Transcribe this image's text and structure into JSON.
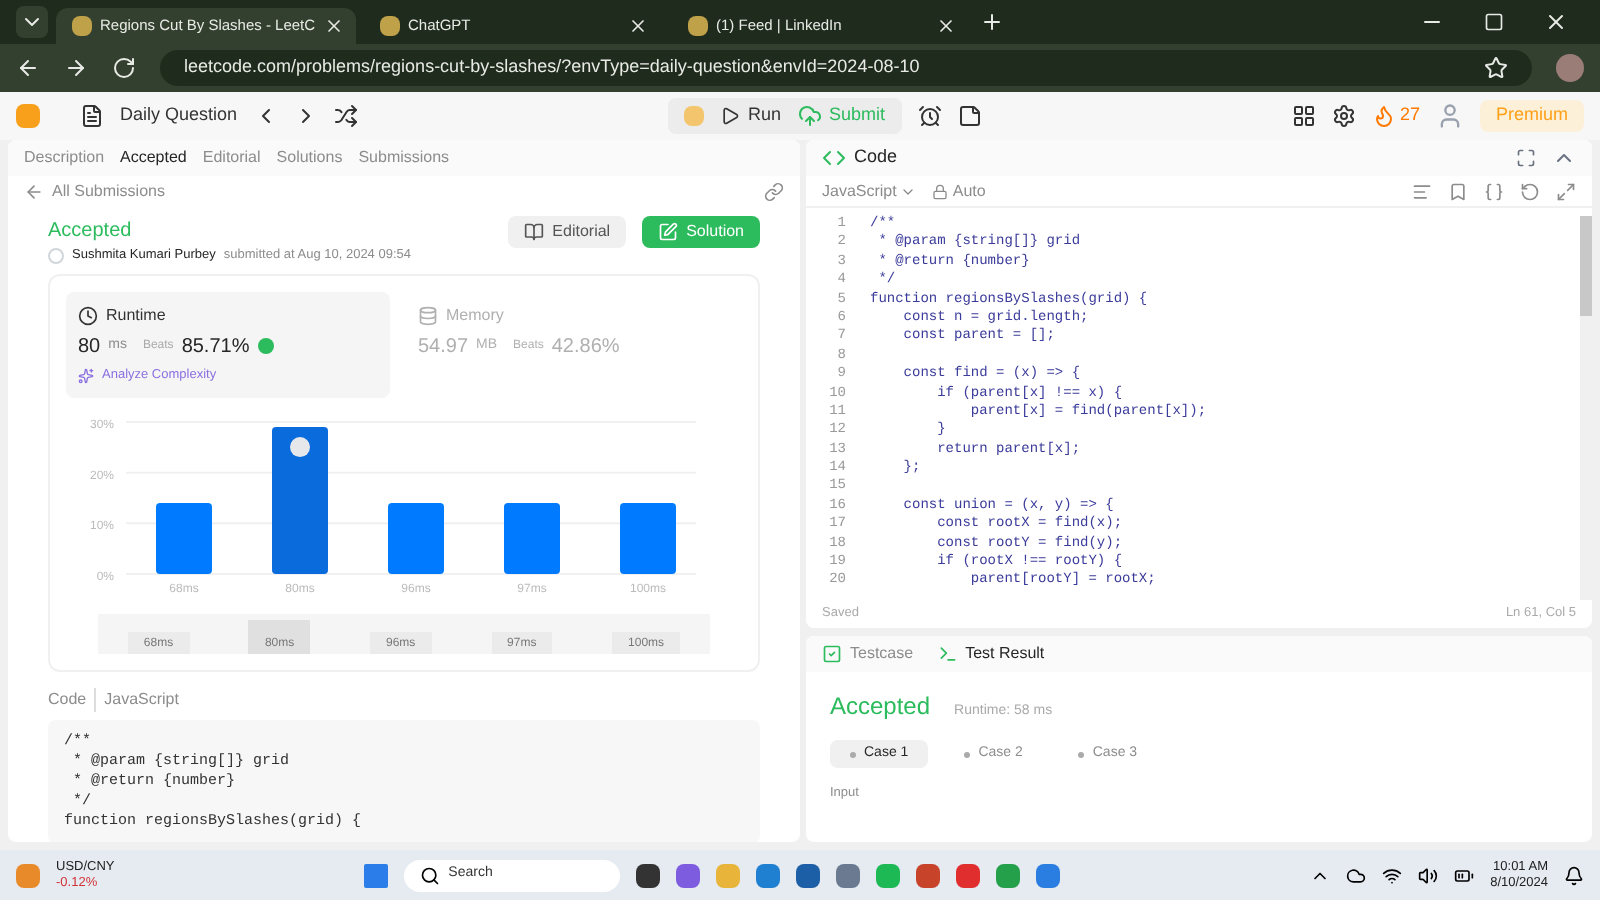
{
  "browser": {
    "tabs": [
      {
        "title": "Regions Cut By Slashes - LeetC",
        "selected": true
      },
      {
        "title": "ChatGPT",
        "selected": false
      },
      {
        "title": "(1) Feed | LinkedIn",
        "selected": false
      }
    ],
    "url": "leetcode.com/problems/regions-cut-by-slashes/?envType=daily-question&envId=2024-08-10"
  },
  "nav": {
    "title": "Daily Question",
    "run": "Run",
    "submit": "Submit",
    "streak": "27",
    "premium": "Premium"
  },
  "left": {
    "tabs": [
      {
        "label": "Description",
        "selected": false
      },
      {
        "label": "Accepted",
        "selected": true
      },
      {
        "label": "Editorial",
        "selected": false
      },
      {
        "label": "Solutions",
        "selected": false
      },
      {
        "label": "Submissions",
        "selected": false
      }
    ],
    "back": "All Submissions",
    "status": "Accepted",
    "user": "Sushmita Kumari Purbey",
    "submitted": "submitted at Aug 10, 2024 09:54",
    "editorial_button": "Editorial",
    "solution_button": "Solution",
    "runtime": {
      "label": "Runtime",
      "value": "80",
      "unit": "ms",
      "beats_label": "Beats",
      "beats": "85.71%",
      "analyze": "Analyze Complexity"
    },
    "memory": {
      "label": "Memory",
      "value": "54.97",
      "unit": "MB",
      "beats_label": "Beats",
      "beats": "42.86%"
    },
    "chart_data": {
      "type": "bar",
      "categories": [
        "68ms",
        "80ms",
        "96ms",
        "97ms",
        "100ms"
      ],
      "values": [
        14,
        29,
        14,
        14,
        14
      ],
      "ylim": [
        0,
        30
      ],
      "yticks": [
        {
          "value": 0,
          "label": "0%"
        },
        {
          "value": 10,
          "label": "10%"
        },
        {
          "value": 20,
          "label": "20%"
        },
        {
          "value": 30,
          "label": "30%"
        }
      ]
    },
    "range_labels": [
      {
        "label": "68ms",
        "selected": false
      },
      {
        "label": "80ms",
        "selected": true
      },
      {
        "label": "96ms",
        "selected": false
      },
      {
        "label": "97ms",
        "selected": false
      },
      {
        "label": "100ms",
        "selected": false
      }
    ],
    "code_label": "Code",
    "code_lang": "JavaScript",
    "code": [
      "/**",
      " * @param {string[]} grid",
      " * @return {number}",
      " */",
      "function regionsBySlashes(grid) {"
    ]
  },
  "editor": {
    "title": "Code",
    "language": "JavaScript",
    "mode": "Auto",
    "lines": [
      {
        "number": "1",
        "text": "/**"
      },
      {
        "number": "2",
        "text": " * @param {string[]} grid"
      },
      {
        "number": "3",
        "text": " * @return {number}"
      },
      {
        "number": "4",
        "text": " */"
      },
      {
        "number": "5",
        "text": "function regionsBySlashes(grid) {"
      },
      {
        "number": "6",
        "text": "    const n = grid.length;"
      },
      {
        "number": "7",
        "text": "    const parent = [];"
      },
      {
        "number": "8"
      },
      {
        "number": "9",
        "text": "    const find = (x) => {"
      },
      {
        "number": "10",
        "text": "        if (parent[x] !== x) {"
      },
      {
        "number": "11",
        "text": "            parent[x] = find(parent[x]);"
      },
      {
        "number": "12",
        "text": "        }"
      },
      {
        "number": "13",
        "text": "        return parent[x];"
      },
      {
        "number": "14",
        "text": "    };"
      },
      {
        "number": "15"
      },
      {
        "number": "16",
        "text": "    const union = (x, y) => {"
      },
      {
        "number": "17",
        "text": "        const rootX = find(x);"
      },
      {
        "number": "18",
        "text": "        const rootY = find(y);"
      },
      {
        "number": "19",
        "text": "        if (rootX !== rootY) {"
      },
      {
        "number": "20",
        "text": "            parent[rootY] = rootX;"
      }
    ],
    "saved": "Saved",
    "position": "Ln 61, Col 5"
  },
  "result": {
    "tabs": [
      {
        "label": "Testcase",
        "selected": false
      },
      {
        "label": "Test Result",
        "selected": true
      }
    ],
    "status": "Accepted",
    "runtime": "Runtime: 58 ms",
    "cases": [
      {
        "label": "Case 1",
        "selected": true
      },
      {
        "label": "Case 2",
        "selected": false
      },
      {
        "label": "Case 3",
        "selected": false
      }
    ],
    "input_label": "Input"
  },
  "taskbar": {
    "ticker": "USD/CNY",
    "change": "-0.12%",
    "search": "Search",
    "time": "10:01 AM",
    "date": "8/10/2024"
  }
}
